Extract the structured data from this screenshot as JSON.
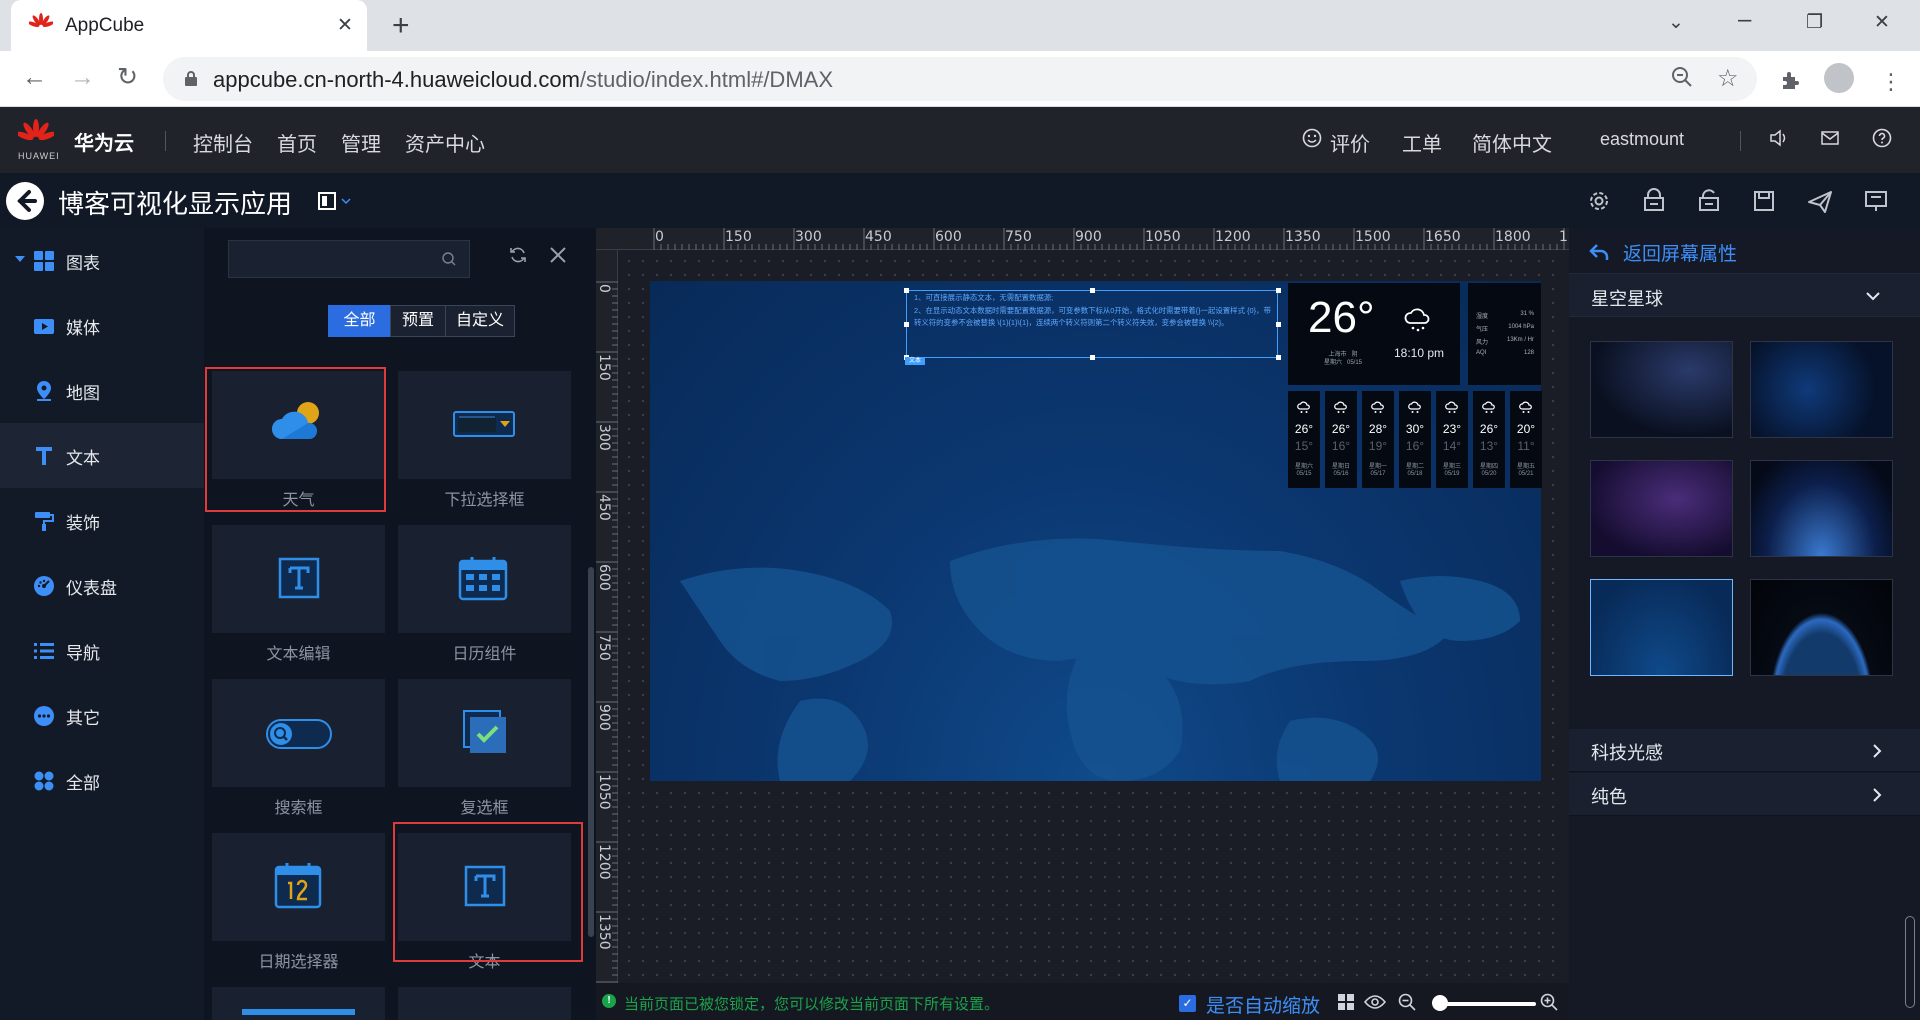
{
  "browser": {
    "tab_title": "AppCube",
    "url_host": "appcube.cn-north-4.huaweicloud.com",
    "url_path": "/studio/index.html#/DMAX"
  },
  "huawei_header": {
    "brand": "华为云",
    "logo_text": "HUAWEI",
    "links": [
      "控制台",
      "首页",
      "管理",
      "资产中心"
    ],
    "feedback": "评价",
    "ticket": "工单",
    "language": "简体中文",
    "user": "eastmount"
  },
  "app": {
    "title": "博客可视化显示应用"
  },
  "left_nav": {
    "items": [
      {
        "label": "图表",
        "icon": "chart-grid-icon"
      },
      {
        "label": "媒体",
        "icon": "media-icon"
      },
      {
        "label": "地图",
        "icon": "map-pin-icon"
      },
      {
        "label": "文本",
        "icon": "text-icon"
      },
      {
        "label": "装饰",
        "icon": "paint-roller-icon"
      },
      {
        "label": "仪表盘",
        "icon": "dashboard-icon"
      },
      {
        "label": "导航",
        "icon": "list-icon"
      },
      {
        "label": "其它",
        "icon": "more-icon"
      },
      {
        "label": "全部",
        "icon": "all-icon"
      }
    ],
    "active_index": 3
  },
  "component_panel": {
    "search_placeholder": "",
    "filters": [
      "全部",
      "预置",
      "自定义"
    ],
    "active_filter": "全部",
    "components": [
      {
        "label": "天气",
        "icon": "weather-cloud-icon"
      },
      {
        "label": "下拉选择框",
        "icon": "dropdown-select-icon"
      },
      {
        "label": "文本编辑",
        "icon": "text-edit-icon"
      },
      {
        "label": "日历组件",
        "icon": "calendar-icon"
      },
      {
        "label": "搜索框",
        "icon": "search-box-icon"
      },
      {
        "label": "复选框",
        "icon": "checkbox-icon"
      },
      {
        "label": "日期选择器",
        "icon": "date-picker-icon"
      },
      {
        "label": "文本",
        "icon": "text-component-icon"
      }
    ]
  },
  "canvas": {
    "ruler_x": [
      "0",
      "150",
      "300",
      "450",
      "600",
      "750",
      "900",
      "1050",
      "1200",
      "1350",
      "1500",
      "1650",
      "1800",
      "1"
    ],
    "ruler_y": [
      "0",
      "150",
      "300",
      "450",
      "600",
      "750",
      "900",
      "1050",
      "1200",
      "1350"
    ],
    "text_widget": {
      "line1": "1、可直接展示静态文本，无需配置数据源;",
      "line2": "2、在显示动态文本数据时需要配置数据源，可变参数下标从0开始，格式化时需要带着{}一起设置样式 {0}，带转义符的变参不会被替换 \\{1}{1}\\{1}，连续两个转义符则第二个转义符失效，变参会被替换 \\\\{2}。",
      "tag": "文本"
    },
    "weather": {
      "temp": "26°",
      "time": "18:10 pm",
      "city": "上海市",
      "condition": "阴",
      "weekday": "星期六",
      "date": "05/15",
      "details": [
        {
          "k": "湿度",
          "v": "31 %"
        },
        {
          "k": "气压",
          "v": "1004 hPa"
        },
        {
          "k": "风力",
          "v": "13Km / Hr"
        },
        {
          "k": "AQI",
          "v": "128"
        }
      ],
      "forecast": [
        {
          "hi": "26°",
          "lo": "15°",
          "wk": "星期六",
          "dt": "05/15"
        },
        {
          "hi": "26°",
          "lo": "16°",
          "wk": "星期日",
          "dt": "05/16"
        },
        {
          "hi": "28°",
          "lo": "19°",
          "wk": "星期一",
          "dt": "05/17"
        },
        {
          "hi": "30°",
          "lo": "16°",
          "wk": "星期二",
          "dt": "05/18"
        },
        {
          "hi": "23°",
          "lo": "14°",
          "wk": "星期三",
          "dt": "05/19"
        },
        {
          "hi": "26°",
          "lo": "13°",
          "wk": "星期四",
          "dt": "05/20"
        },
        {
          "hi": "20°",
          "lo": "11°",
          "wk": "星期五",
          "dt": "05/21"
        }
      ]
    }
  },
  "status_bar": {
    "message": "当前页面已被您锁定，您可以修改当前页面下所有设置。",
    "auto_scale_label": "是否自动缩放",
    "auto_scale_checked": true
  },
  "right_panel": {
    "back_label": "返回屏幕属性",
    "section_starry": "星空星球",
    "section_tech": "科技光感",
    "section_solid": "纯色",
    "selected_thumbnail": 5
  }
}
